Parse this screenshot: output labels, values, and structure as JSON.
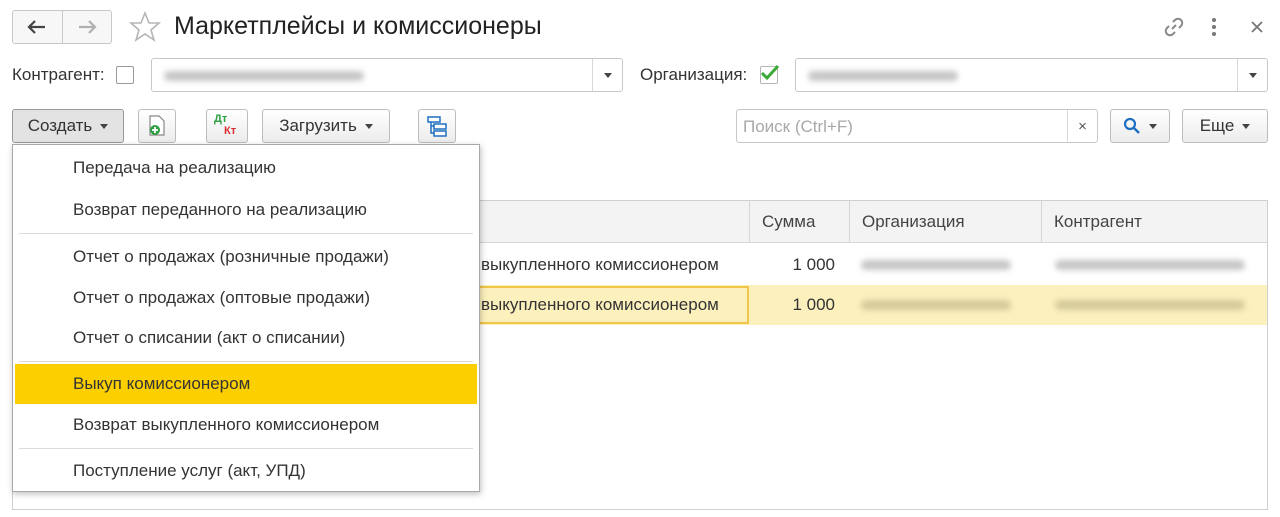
{
  "window": {
    "title": "Маркетплейсы и комиссионеры",
    "back_icon": "arrow-left-icon",
    "forward_icon": "arrow-right-icon",
    "favorite_icon": "star-icon",
    "link_icon": "link-icon",
    "more_icon": "more-vertical-icon",
    "close_icon": "close-icon"
  },
  "filters": {
    "counterparty_label": "Контрагент:",
    "counterparty_checked": false,
    "organization_label": "Организация:",
    "organization_checked": true
  },
  "toolbar": {
    "create_label": "Создать",
    "load_label": "Загрузить",
    "dt_top": "Дт",
    "dt_bottom": "Кт",
    "search_placeholder": "Поиск (Ctrl+F)",
    "clear_symbol": "×",
    "more_label": "Еще"
  },
  "table": {
    "columns": [
      "Сумма",
      "Организация",
      "Контрагент"
    ],
    "rows": [
      {
        "doc": "выкупленного комиссионером",
        "sum": "1 000"
      },
      {
        "doc": "выкупленного комиссионером",
        "sum": "1 000"
      }
    ]
  },
  "create_menu": {
    "items": [
      "Передача на реализацию",
      "Возврат переданного на реализацию",
      "Отчет о продажах (розничные продажи)",
      "Отчет о продажах (оптовые продажи)",
      "Отчет о списании (акт о списании)",
      "Выкуп комиссионером",
      "Возврат выкупленного комиссионером",
      "Поступление услуг (акт, УПД)"
    ],
    "highlighted_index": 5
  },
  "colors": {
    "highlight": "#fccf00",
    "selected_row": "#fcf1bd",
    "check_green": "#3aa935",
    "accent_blue": "#1f6fc0"
  }
}
